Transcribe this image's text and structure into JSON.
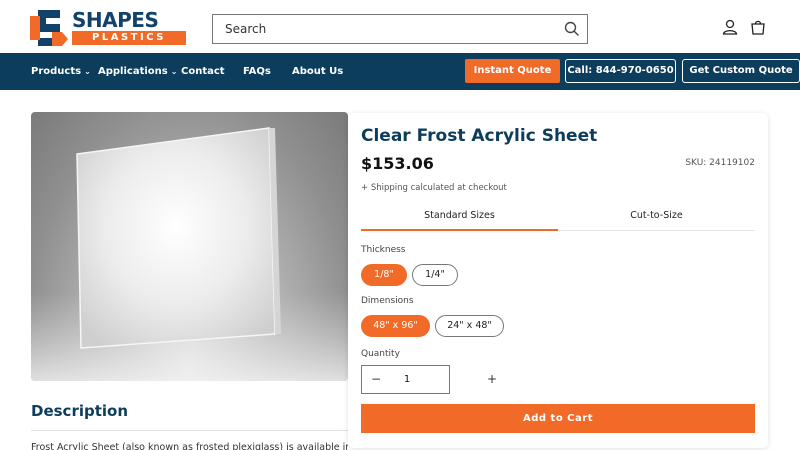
{
  "header": {
    "logo_line1": "SHAPES",
    "logo_line2": "PLASTICS",
    "search_placeholder": "Search"
  },
  "nav": {
    "items": [
      {
        "label": "Products",
        "has_dropdown": true
      },
      {
        "label": "Applications",
        "has_dropdown": true
      },
      {
        "label": "Contact",
        "has_dropdown": false
      },
      {
        "label": "FAQs",
        "has_dropdown": false
      },
      {
        "label": "About Us",
        "has_dropdown": false
      }
    ],
    "instant_quote": "Instant Quote",
    "call": "Call: 844-970-0650",
    "custom_quote": "Get Custom Quote"
  },
  "product": {
    "title": "Clear Frost Acrylic Sheet",
    "price": "$153.06",
    "sku": "SKU: 24119102",
    "shipping": "+ Shipping calculated at checkout",
    "tabs": [
      {
        "label": "Standard Sizes",
        "active": true
      },
      {
        "label": "Cut-to-Size",
        "active": false
      }
    ],
    "thickness_label": "Thickness",
    "thickness_options": [
      {
        "label": "1/8\"",
        "selected": true
      },
      {
        "label": "1/4\"",
        "selected": false
      }
    ],
    "dimensions_label": "Dimensions",
    "dimension_options": [
      {
        "label": "48\" x 96\"",
        "selected": true
      },
      {
        "label": "24\" x 48\"",
        "selected": false
      }
    ],
    "quantity_label": "Quantity",
    "quantity": "1",
    "minus": "−",
    "plus": "+",
    "add_to_cart": "Add to Cart"
  },
  "description": {
    "title": "Description",
    "text": "Frost Acrylic Sheet (also known as frosted plexiglass) is available in"
  },
  "colors": {
    "brand_navy": "#0d3d5c",
    "brand_orange": "#f26a28"
  },
  "icons": [
    "search-icon",
    "account-icon",
    "cart-icon",
    "chevron-down-icon"
  ]
}
